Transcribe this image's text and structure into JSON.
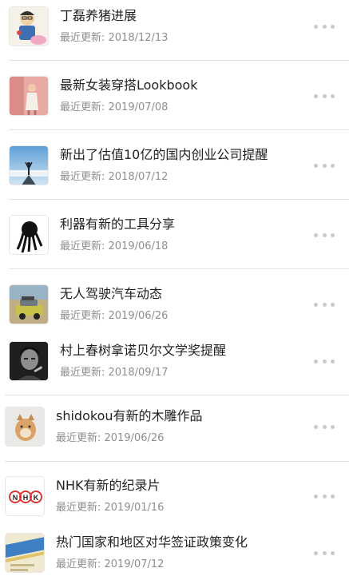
{
  "list": {
    "items": [
      {
        "title": "丁磊养猪进展",
        "updated": "最近更新: 2018/12/13",
        "icon": "cartoon-avatar-pig-icon"
      },
      {
        "title": "最新女装穿搭Lookbook",
        "updated": "最近更新: 2019/07/08",
        "icon": "fashion-photo-icon"
      },
      {
        "title": "新出了估值10亿的国内创业公司提醒",
        "updated": "最近更新: 2018/07/12",
        "icon": "mountain-summit-icon"
      },
      {
        "title": "利器有新的工具分享",
        "updated": "最近更新: 2019/06/18",
        "icon": "octopus-logo-icon"
      },
      {
        "title": "无人驾驶汽车动态",
        "updated": "最近更新: 2019/06/26",
        "icon": "car-photo-icon"
      },
      {
        "title": "村上春树拿诺贝尔文学奖提醒",
        "updated": "最近更新: 2018/09/17",
        "icon": "author-portrait-icon"
      },
      {
        "title": "shidokou有新的木雕作品",
        "updated": "最近更新: 2019/06/26",
        "icon": "wood-dog-carving-icon"
      },
      {
        "title": "NHK有新的纪录片",
        "updated": "最近更新: 2019/01/16",
        "icon": "nhk-logo-icon"
      },
      {
        "title": "热门国家和地区对华签证政策变化",
        "updated": "最近更新: 2019/07/12",
        "icon": "passport-visa-icon"
      }
    ],
    "more_icon": "more-dots-icon",
    "nhk_logo_letters": [
      "N",
      "H",
      "K"
    ]
  }
}
